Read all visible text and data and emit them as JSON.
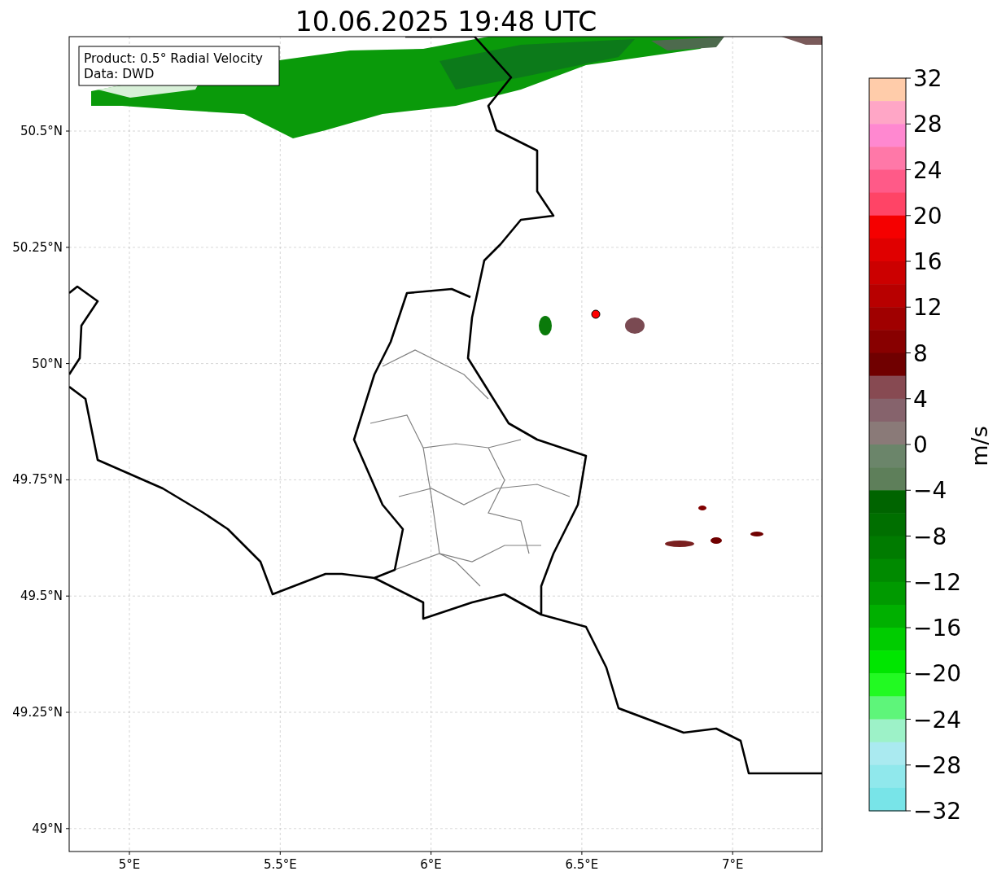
{
  "title": "10.06.2025 19:48 UTC",
  "info_box": [
    "Product: 0.5° Radial Velocity",
    "Data: DWD"
  ],
  "lat_ticks": [
    "50.5°N",
    "50.25°N",
    "50°N",
    "49.75°N",
    "49.5°N",
    "49.25°N",
    "49°N"
  ],
  "lon_ticks": [
    "5°E",
    "5.5°E",
    "6°E",
    "6.5°E",
    "7°E"
  ],
  "colorbar": {
    "label": "m/s",
    "ticks": [
      "32",
      "28",
      "24",
      "20",
      "16",
      "12",
      "8",
      "4",
      "0",
      "−4",
      "−8",
      "−12",
      "−16",
      "−20",
      "−24",
      "−28",
      "−32"
    ],
    "segments": [
      {
        "color": "#ffccaa"
      },
      {
        "color": "#ffa6c6"
      },
      {
        "color": "#ff88d0"
      },
      {
        "color": "#ff78a8"
      },
      {
        "color": "#ff5a88"
      },
      {
        "color": "#ff4466"
      },
      {
        "color": "#f50000"
      },
      {
        "color": "#e00000"
      },
      {
        "color": "#cc0000"
      },
      {
        "color": "#b80000"
      },
      {
        "color": "#a00000"
      },
      {
        "color": "#880000"
      },
      {
        "color": "#700000"
      },
      {
        "color": "#874a52"
      },
      {
        "color": "#86636c"
      },
      {
        "color": "#8a7a78"
      },
      {
        "color": "#6b856a"
      },
      {
        "color": "#5e7f5a"
      },
      {
        "color": "#006400"
      },
      {
        "color": "#006f00"
      },
      {
        "color": "#007b00"
      },
      {
        "color": "#008a00"
      },
      {
        "color": "#009a00"
      },
      {
        "color": "#00b000"
      },
      {
        "color": "#00cc00"
      },
      {
        "color": "#00e600"
      },
      {
        "color": "#22fa22"
      },
      {
        "color": "#5ef57a"
      },
      {
        "color": "#9df2c8"
      },
      {
        "color": "#aaeaf0"
      },
      {
        "color": "#90e8ec"
      },
      {
        "color": "#78e4e8"
      }
    ]
  }
}
